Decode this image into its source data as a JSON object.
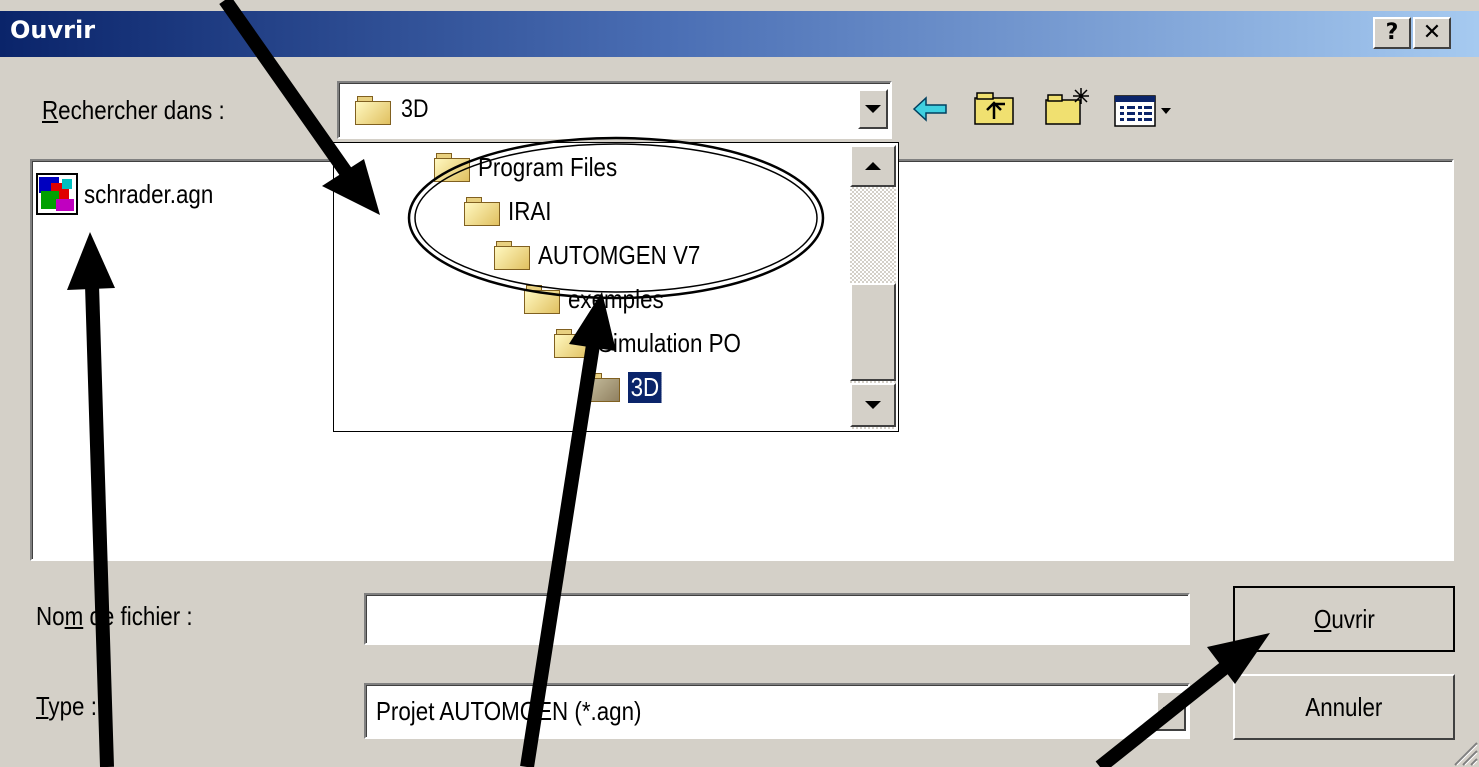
{
  "window": {
    "title": "Ouvrir",
    "help_glyph": "?",
    "close_glyph": "✕"
  },
  "look_in": {
    "label_first": "R",
    "label_rest": "echercher dans :",
    "value": "3D"
  },
  "folder_tree": [
    {
      "label": "Program Files",
      "indent": 0
    },
    {
      "label": "IRAI",
      "indent": 1
    },
    {
      "label": "AUTOMGEN V7",
      "indent": 2
    },
    {
      "label": "exemples",
      "indent": 3
    },
    {
      "label": "Simulation PO",
      "indent": 4
    },
    {
      "label": "3D",
      "indent": 5,
      "selected": true
    }
  ],
  "files": [
    {
      "name": "schrader.agn",
      "icon": "automgen-project-icon"
    }
  ],
  "filename": {
    "label_a": "No",
    "label_u": "m",
    "label_b": " de fichier :",
    "value": ""
  },
  "type": {
    "label_u": "T",
    "label_rest": "ype :",
    "value": "Projet AUTOMGEN (*.agn)"
  },
  "buttons": {
    "open_u": "O",
    "open_rest": "uvrir",
    "cancel": "Annuler"
  },
  "colors": {
    "titlebar_start": "#0a246a",
    "titlebar_end": "#a6caf0",
    "face": "#d4d0c8",
    "selection": "#0a246a"
  }
}
